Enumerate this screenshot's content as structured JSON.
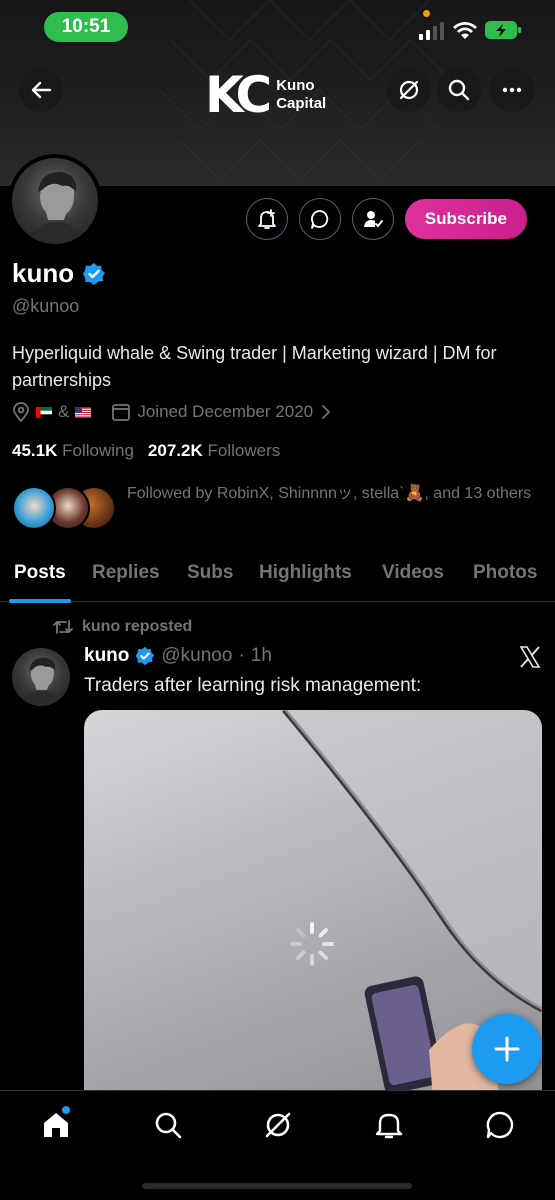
{
  "status": {
    "time": "10:51"
  },
  "banner": {
    "logo_mark": "KC",
    "logo_line1": "Kuno",
    "logo_line2": "Capital"
  },
  "profile": {
    "name": "kuno",
    "handle": "@kunoo",
    "bio": "Hyperliquid whale & Swing trader | Marketing wizard | DM for partnerships",
    "location_sep": "&",
    "joined": "Joined December 2020",
    "following_count": "45.1K",
    "following_label": "Following",
    "followers_count": "207.2K",
    "followers_label": "Followers",
    "followed_by": "Followed by RobinX, Shinnnnッ, stella`🧸, and 13 others",
    "subscribe_label": "Subscribe"
  },
  "tabs": [
    "Posts",
    "Replies",
    "Subs",
    "Highlights",
    "Videos",
    "Photos"
  ],
  "post": {
    "repost_label": "kuno reposted",
    "author": "kuno",
    "handle": "@kunoo",
    "dot": "·",
    "time": "1h",
    "text": "Traders after learning risk management:"
  },
  "colors": {
    "accent": "#1d9bf0",
    "subscribe": "#e0319b",
    "muted": "#71767b"
  },
  "icons": [
    "back-arrow-icon",
    "grok-icon",
    "search-icon",
    "more-icon",
    "notification-add-icon",
    "message-icon",
    "follow-check-icon",
    "location-icon",
    "calendar-icon",
    "repost-icon",
    "verified-icon",
    "x-logo-icon",
    "loading-icon",
    "plus-icon",
    "home-icon",
    "search-nav-icon",
    "grok-nav-icon",
    "bell-icon",
    "messages-nav-icon"
  ]
}
